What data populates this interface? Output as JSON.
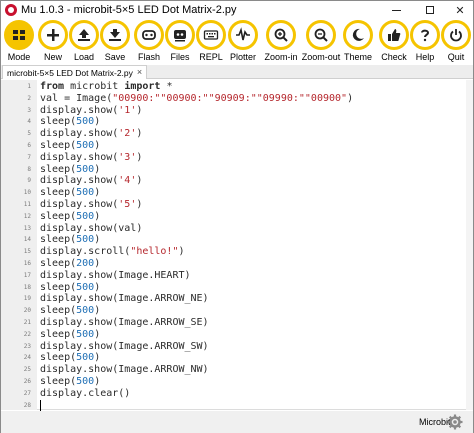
{
  "window": {
    "title": "Mu 1.0.3 - microbit-5×5 LED Dot Matrix-2.py",
    "controls": {
      "minimize_icon": "minimize-icon",
      "maximize_icon": "maximize-icon",
      "close_label": "✕"
    }
  },
  "toolbar": {
    "accent_color": "#f5c400",
    "buttons": [
      {
        "label": "Mode",
        "icon": "mode-icon"
      },
      {
        "label": "New",
        "icon": "plus-icon"
      },
      {
        "label": "Load",
        "icon": "upload-icon"
      },
      {
        "label": "Save",
        "icon": "download-icon"
      },
      {
        "label": "Flash",
        "icon": "microbit-icon"
      },
      {
        "label": "Files",
        "icon": "microbit-files-icon"
      },
      {
        "label": "REPL",
        "icon": "keyboard-icon"
      },
      {
        "label": "Plotter",
        "icon": "waveform-icon"
      },
      {
        "label": "Zoom-in",
        "icon": "zoom-in-icon"
      },
      {
        "label": "Zoom-out",
        "icon": "zoom-out-icon"
      },
      {
        "label": "Theme",
        "icon": "moon-icon"
      },
      {
        "label": "Check",
        "icon": "thumbs-up-icon"
      },
      {
        "label": "Help",
        "icon": "question-icon"
      },
      {
        "label": "Quit",
        "icon": "power-icon"
      }
    ]
  },
  "tab": {
    "label": "microbit-5×5 LED Dot Matrix-2.py",
    "close_label": "×"
  },
  "editor": {
    "line_numbers": [
      "1",
      "2",
      "3",
      "4",
      "5",
      "6",
      "7",
      "8",
      "9",
      "10",
      "11",
      "12",
      "13",
      "14",
      "15",
      "16",
      "17",
      "18",
      "19",
      "20",
      "21",
      "22",
      "23",
      "24",
      "25",
      "26",
      "27",
      "28"
    ],
    "lines": [
      {
        "segments": [
          {
            "text": "from",
            "color": "#2b2b2b",
            "bold": true
          },
          {
            "text": " microbit ",
            "color": "#2b2b2b",
            "bold": false
          },
          {
            "text": "import",
            "color": "#2b2b2b",
            "bold": true
          },
          {
            "text": " *",
            "color": "#2b2b2b",
            "bold": false
          }
        ]
      },
      {
        "segments": [
          {
            "text": "val = Image(",
            "color": "#2b2b2b",
            "bold": false
          },
          {
            "text": "\"00900:\"\"00900:\"\"90909:\"\"09990:\"\"00900\"",
            "color": "#b5272d",
            "bold": false
          },
          {
            "text": ")",
            "color": "#2b2b2b",
            "bold": false
          }
        ]
      },
      {
        "segments": [
          {
            "text": "display.show(",
            "color": "#2b2b2b",
            "bold": false
          },
          {
            "text": "'1'",
            "color": "#b5272d",
            "bold": false
          },
          {
            "text": ")",
            "color": "#2b2b2b",
            "bold": false
          }
        ]
      },
      {
        "segments": [
          {
            "text": "sleep(",
            "color": "#2b2b2b",
            "bold": false
          },
          {
            "text": "500",
            "color": "#1f6fb5",
            "bold": false
          },
          {
            "text": ")",
            "color": "#2b2b2b",
            "bold": false
          }
        ]
      },
      {
        "segments": [
          {
            "text": "display.show(",
            "color": "#2b2b2b",
            "bold": false
          },
          {
            "text": "'2'",
            "color": "#b5272d",
            "bold": false
          },
          {
            "text": ")",
            "color": "#2b2b2b",
            "bold": false
          }
        ]
      },
      {
        "segments": [
          {
            "text": "sleep(",
            "color": "#2b2b2b",
            "bold": false
          },
          {
            "text": "500",
            "color": "#1f6fb5",
            "bold": false
          },
          {
            "text": ")",
            "color": "#2b2b2b",
            "bold": false
          }
        ]
      },
      {
        "segments": [
          {
            "text": "display.show(",
            "color": "#2b2b2b",
            "bold": false
          },
          {
            "text": "'3'",
            "color": "#b5272d",
            "bold": false
          },
          {
            "text": ")",
            "color": "#2b2b2b",
            "bold": false
          }
        ]
      },
      {
        "segments": [
          {
            "text": "sleep(",
            "color": "#2b2b2b",
            "bold": false
          },
          {
            "text": "500",
            "color": "#1f6fb5",
            "bold": false
          },
          {
            "text": ")",
            "color": "#2b2b2b",
            "bold": false
          }
        ]
      },
      {
        "segments": [
          {
            "text": "display.show(",
            "color": "#2b2b2b",
            "bold": false
          },
          {
            "text": "'4'",
            "color": "#b5272d",
            "bold": false
          },
          {
            "text": ")",
            "color": "#2b2b2b",
            "bold": false
          }
        ]
      },
      {
        "segments": [
          {
            "text": "sleep(",
            "color": "#2b2b2b",
            "bold": false
          },
          {
            "text": "500",
            "color": "#1f6fb5",
            "bold": false
          },
          {
            "text": ")",
            "color": "#2b2b2b",
            "bold": false
          }
        ]
      },
      {
        "segments": [
          {
            "text": "display.show(",
            "color": "#2b2b2b",
            "bold": false
          },
          {
            "text": "'5'",
            "color": "#b5272d",
            "bold": false
          },
          {
            "text": ")",
            "color": "#2b2b2b",
            "bold": false
          }
        ]
      },
      {
        "segments": [
          {
            "text": "sleep(",
            "color": "#2b2b2b",
            "bold": false
          },
          {
            "text": "500",
            "color": "#1f6fb5",
            "bold": false
          },
          {
            "text": ")",
            "color": "#2b2b2b",
            "bold": false
          }
        ]
      },
      {
        "segments": [
          {
            "text": "display.show(val)",
            "color": "#2b2b2b",
            "bold": false
          }
        ]
      },
      {
        "segments": [
          {
            "text": "sleep(",
            "color": "#2b2b2b",
            "bold": false
          },
          {
            "text": "500",
            "color": "#1f6fb5",
            "bold": false
          },
          {
            "text": ")",
            "color": "#2b2b2b",
            "bold": false
          }
        ]
      },
      {
        "segments": [
          {
            "text": "display.scroll(",
            "color": "#2b2b2b",
            "bold": false
          },
          {
            "text": "\"hello!\"",
            "color": "#b5272d",
            "bold": false
          },
          {
            "text": ")",
            "color": "#2b2b2b",
            "bold": false
          }
        ]
      },
      {
        "segments": [
          {
            "text": "sleep(",
            "color": "#2b2b2b",
            "bold": false
          },
          {
            "text": "200",
            "color": "#1f6fb5",
            "bold": false
          },
          {
            "text": ")",
            "color": "#2b2b2b",
            "bold": false
          }
        ]
      },
      {
        "segments": [
          {
            "text": "display.show(Image.HEART)",
            "color": "#2b2b2b",
            "bold": false
          }
        ]
      },
      {
        "segments": [
          {
            "text": "sleep(",
            "color": "#2b2b2b",
            "bold": false
          },
          {
            "text": "500",
            "color": "#1f6fb5",
            "bold": false
          },
          {
            "text": ")",
            "color": "#2b2b2b",
            "bold": false
          }
        ]
      },
      {
        "segments": [
          {
            "text": "display.show(Image.ARROW_NE)",
            "color": "#2b2b2b",
            "bold": false
          }
        ]
      },
      {
        "segments": [
          {
            "text": "sleep(",
            "color": "#2b2b2b",
            "bold": false
          },
          {
            "text": "500",
            "color": "#1f6fb5",
            "bold": false
          },
          {
            "text": ")",
            "color": "#2b2b2b",
            "bold": false
          }
        ]
      },
      {
        "segments": [
          {
            "text": "display.show(Image.ARROW_SE)",
            "color": "#2b2b2b",
            "bold": false
          }
        ]
      },
      {
        "segments": [
          {
            "text": "sleep(",
            "color": "#2b2b2b",
            "bold": false
          },
          {
            "text": "500",
            "color": "#1f6fb5",
            "bold": false
          },
          {
            "text": ")",
            "color": "#2b2b2b",
            "bold": false
          }
        ]
      },
      {
        "segments": [
          {
            "text": "display.show(Image.ARROW_SW)",
            "color": "#2b2b2b",
            "bold": false
          }
        ]
      },
      {
        "segments": [
          {
            "text": "sleep(",
            "color": "#2b2b2b",
            "bold": false
          },
          {
            "text": "500",
            "color": "#1f6fb5",
            "bold": false
          },
          {
            "text": ")",
            "color": "#2b2b2b",
            "bold": false
          }
        ]
      },
      {
        "segments": [
          {
            "text": "display.show(Image.ARROW_NW)",
            "color": "#2b2b2b",
            "bold": false
          }
        ]
      },
      {
        "segments": [
          {
            "text": "sleep(",
            "color": "#2b2b2b",
            "bold": false
          },
          {
            "text": "500",
            "color": "#1f6fb5",
            "bold": false
          },
          {
            "text": ")",
            "color": "#2b2b2b",
            "bold": false
          }
        ]
      },
      {
        "segments": [
          {
            "text": "display.clear()",
            "color": "#2b2b2b",
            "bold": false
          }
        ]
      },
      {
        "segments": []
      }
    ]
  },
  "statusbar": {
    "mode": "Microbit",
    "settings_icon": "gear-icon"
  }
}
